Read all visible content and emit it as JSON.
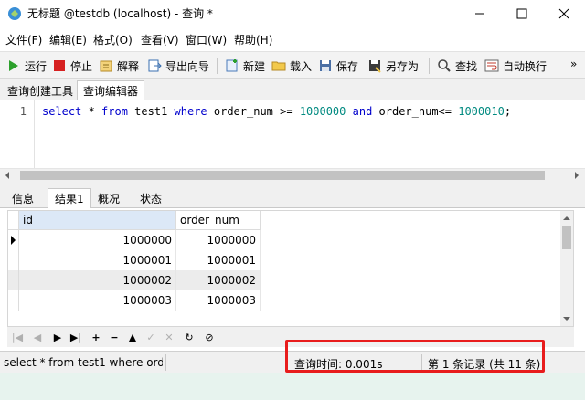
{
  "window": {
    "title": "无标题 @testdb (localhost) - 查询 *",
    "controls": [
      "minimize",
      "maximize",
      "close"
    ]
  },
  "menu": [
    "文件(F)",
    "编辑(E)",
    "格式(O)",
    "查看(V)",
    "窗口(W)",
    "帮助(H)"
  ],
  "toolbar": {
    "run": "运行",
    "stop": "停止",
    "explain": "解释",
    "export_wizard": "导出向导",
    "new": "新建",
    "load": "载入",
    "save": "保存",
    "save_as": "另存为",
    "find": "查找",
    "word_wrap": "自动换行"
  },
  "editor_tabs": [
    "查询创建工具",
    "查询编辑器"
  ],
  "editor": {
    "line_number": "1",
    "code_tokens": [
      {
        "t": "select",
        "c": "kw"
      },
      {
        "t": " * ",
        "c": "plain"
      },
      {
        "t": "from",
        "c": "kw"
      },
      {
        "t": " test1 ",
        "c": "plain"
      },
      {
        "t": "where",
        "c": "kw"
      },
      {
        "t": " order_num >= ",
        "c": "plain"
      },
      {
        "t": "1000000",
        "c": "num"
      },
      {
        "t": " ",
        "c": "plain"
      },
      {
        "t": "and",
        "c": "kw"
      },
      {
        "t": " order_num<= ",
        "c": "plain"
      },
      {
        "t": "1000010",
        "c": "num"
      },
      {
        "t": ";",
        "c": "plain"
      }
    ]
  },
  "result_tabs": [
    "信息",
    "结果1",
    "概况",
    "状态"
  ],
  "grid": {
    "columns": [
      "id",
      "order_num"
    ],
    "rows": [
      [
        "1000000",
        "1000000"
      ],
      [
        "1000001",
        "1000001"
      ],
      [
        "1000002",
        "1000002"
      ],
      [
        "1000003",
        "1000003"
      ]
    ]
  },
  "status": {
    "sql_preview": "select * from test1 where order",
    "query_time": "查询时间: 0.001s",
    "record_info": "第 1 条记录 (共 11 条)"
  },
  "colors": {
    "highlight_border": "#e81c1c",
    "keyword": "#0000cc",
    "number": "#008a80"
  }
}
